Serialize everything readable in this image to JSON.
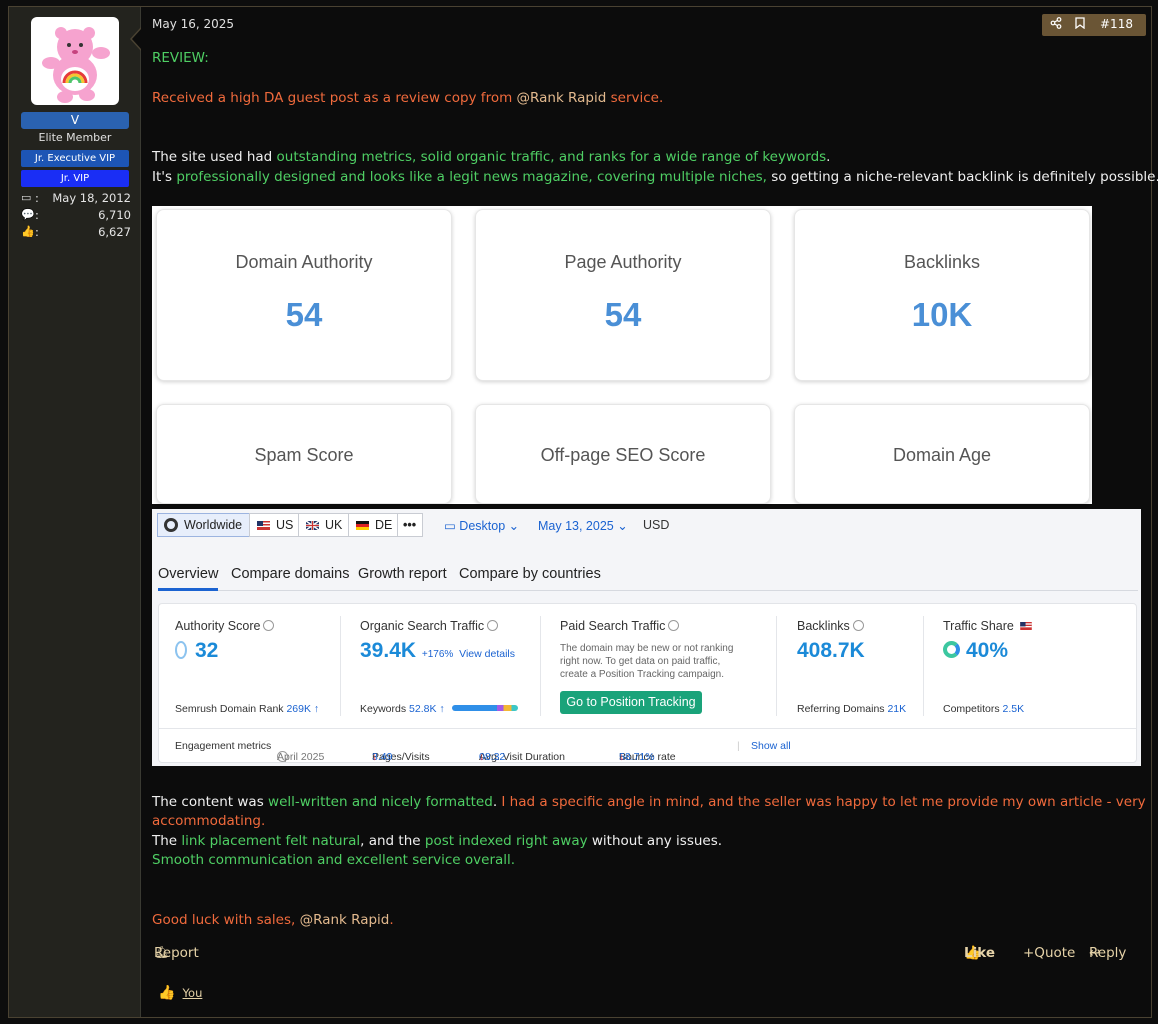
{
  "user": {
    "name": "V",
    "title": "Elite Member",
    "banners": [
      "Jr. Executive VIP",
      "Jr. VIP"
    ],
    "stats": [
      {
        "icon": "calendar-icon",
        "value": "May 18, 2012"
      },
      {
        "icon": "messages-icon",
        "value": "6,710"
      },
      {
        "icon": "thumbs-up-icon",
        "value": "6,627"
      }
    ]
  },
  "post": {
    "date": "May 16, 2025",
    "number": "#118",
    "lines": {
      "review": "REVIEW:",
      "received": "Received a high DA guest post as a review copy from",
      "mention1": "@Rank Rapid",
      "received_end": "service.",
      "site_a": "The site used had",
      "site_b": "outstanding metrics, solid organic traffic, and ranks for a wide range of keywords",
      "site_c": ".",
      "its_a": "It's",
      "its_b": "professionally designed and looks like a legit news magazine, covering multiple niches,",
      "its_c": "so getting a niche-relevant backlink is definitely possible.",
      "content_a": "The content was",
      "content_b": "well-written and nicely formatted",
      "content_c": ".",
      "content_d": "I had a specific angle in mind, and the seller was happy to let me provide my own article - very",
      "content_e": "accommodating.",
      "link_a": "The",
      "link_b": "link placement felt natural",
      "link_c": ", and the",
      "link_d": "post indexed right away",
      "link_e": "without any issues.",
      "smooth": "Smooth communication and excellent service overall.",
      "luck_a": "Good luck with sales,",
      "luck_b": "@Rank Rapid",
      "luck_c": "."
    },
    "actions": {
      "report": "Report",
      "like": "Like",
      "quote": "+Quote",
      "reply": "Reply"
    },
    "reaction_user": "You"
  },
  "cards": [
    {
      "label": "Domain Authority",
      "value": "54"
    },
    {
      "label": "Page Authority",
      "value": "54"
    },
    {
      "label": "Backlinks",
      "value": "10K"
    },
    {
      "label": "Spam Score",
      "value": ""
    },
    {
      "label": "Off-page SEO Score",
      "value": ""
    },
    {
      "label": "Domain Age",
      "value": ""
    }
  ],
  "semrush": {
    "regions": [
      "Worldwide",
      "US",
      "UK",
      "DE",
      "•••"
    ],
    "device": "Desktop",
    "date": "May 13, 2025",
    "currency": "USD",
    "tabs": [
      "Overview",
      "Compare domains",
      "Growth report",
      "Compare by countries"
    ],
    "authority": {
      "label": "Authority Score",
      "value": "32",
      "foot_label": "Semrush Domain Rank",
      "foot_value": "269K ↑"
    },
    "organic": {
      "label": "Organic Search Traffic",
      "value": "39.4K",
      "change": "+176%",
      "link": "View details",
      "foot_label": "Keywords",
      "foot_value": "52.8K ↑"
    },
    "paid": {
      "label": "Paid Search Traffic",
      "note": "The domain may be new or not ranking right now. To get data on paid traffic, create a Position Tracking campaign.",
      "button": "Go to Position Tracking"
    },
    "backlinks": {
      "label": "Backlinks",
      "value": "408.7K",
      "foot_label": "Referring Domains",
      "foot_value": "21K"
    },
    "traffic_share": {
      "label": "Traffic Share",
      "value": "40%",
      "foot_label": "Competitors",
      "foot_value": "2.5K"
    },
    "engagement": {
      "label": "Engagement metrics",
      "month": "April 2025",
      "pages_label": "Pages/Visits",
      "pages_value": "3.49",
      "duration_label": "Avg. Visit Duration",
      "duration_value": "08:32",
      "bounce_label": "Bounce rate",
      "bounce_value": "58.71%",
      "show_all": "Show all"
    }
  },
  "colors": {
    "green": "#4fcf64",
    "orange": "#f06a3c",
    "tan": "#e2b98e",
    "semrush_blue": "#1b8ad8"
  }
}
